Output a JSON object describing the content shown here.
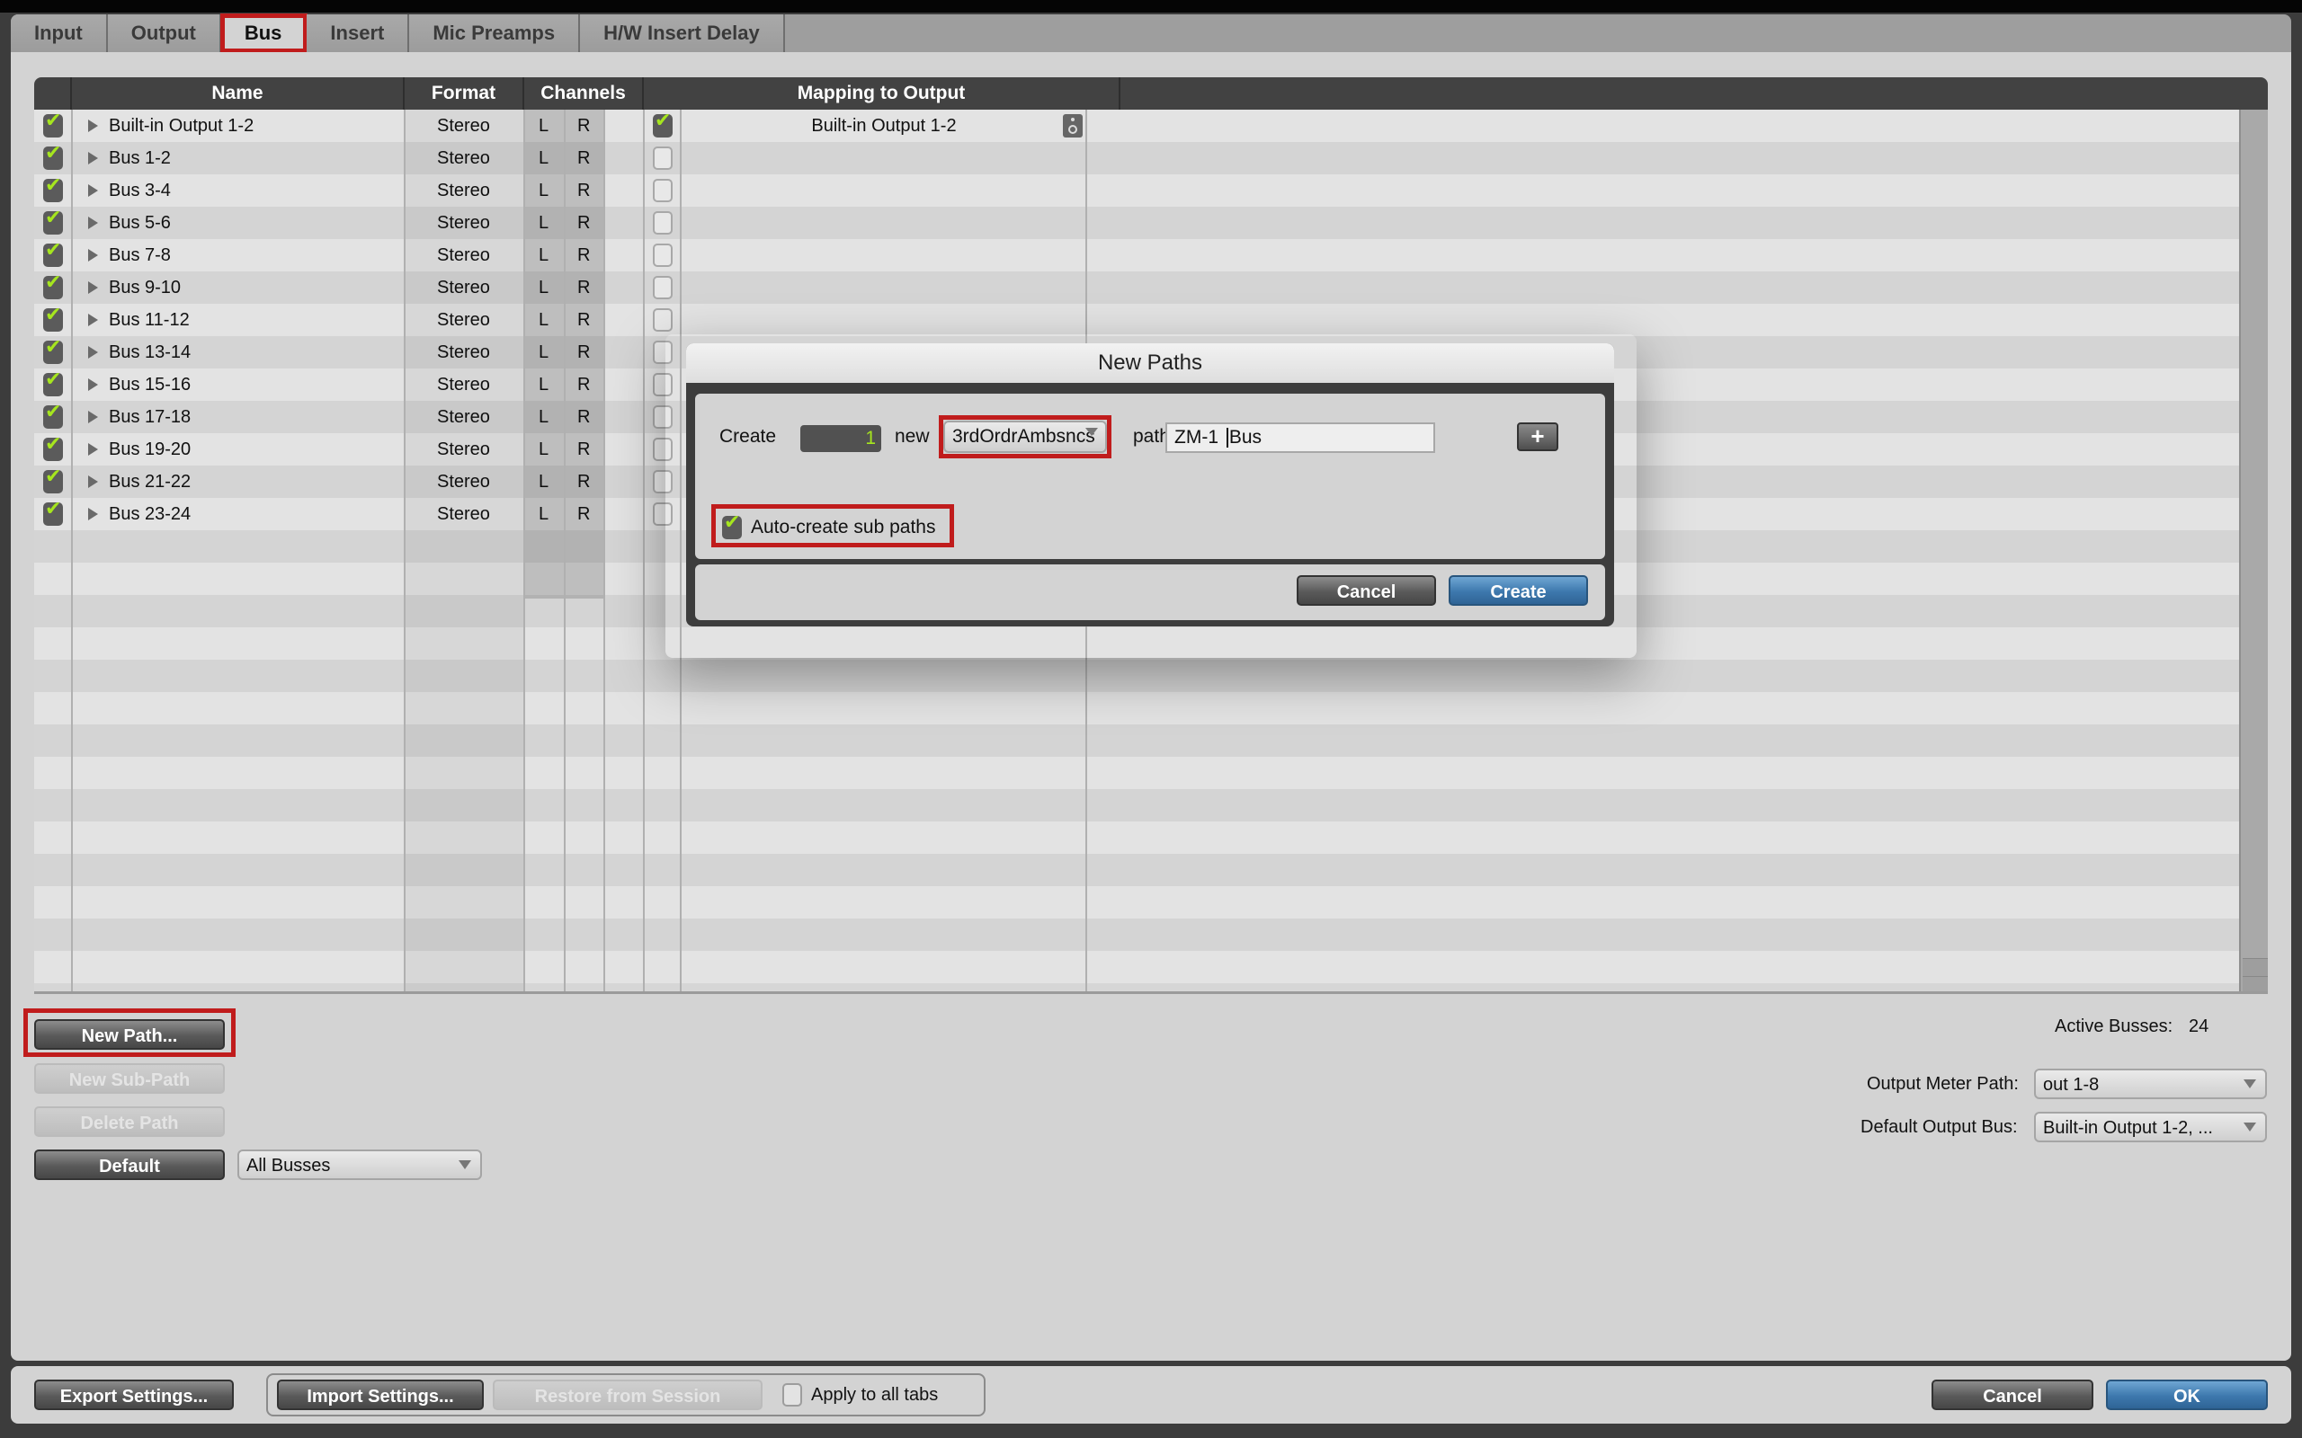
{
  "tabs": [
    {
      "label": "Input",
      "active": false
    },
    {
      "label": "Output",
      "active": false
    },
    {
      "label": "Bus",
      "active": true
    },
    {
      "label": "Insert",
      "active": false
    },
    {
      "label": "Mic Preamps",
      "active": false
    },
    {
      "label": "H/W Insert Delay",
      "active": false
    }
  ],
  "table": {
    "headers": {
      "name": "Name",
      "format": "Format",
      "channels": "Channels",
      "mapping": "Mapping to Output"
    },
    "rows": [
      {
        "active": true,
        "name": "Built-in Output 1-2",
        "format": "Stereo",
        "ch_l": "L",
        "ch_r": "R",
        "mapped": true,
        "mapping": "Built-in Output 1-2"
      },
      {
        "active": true,
        "name": "Bus 1-2",
        "format": "Stereo",
        "ch_l": "L",
        "ch_r": "R",
        "mapped": false,
        "mapping": ""
      },
      {
        "active": true,
        "name": "Bus 3-4",
        "format": "Stereo",
        "ch_l": "L",
        "ch_r": "R",
        "mapped": false,
        "mapping": ""
      },
      {
        "active": true,
        "name": "Bus 5-6",
        "format": "Stereo",
        "ch_l": "L",
        "ch_r": "R",
        "mapped": false,
        "mapping": ""
      },
      {
        "active": true,
        "name": "Bus 7-8",
        "format": "Stereo",
        "ch_l": "L",
        "ch_r": "R",
        "mapped": false,
        "mapping": ""
      },
      {
        "active": true,
        "name": "Bus 9-10",
        "format": "Stereo",
        "ch_l": "L",
        "ch_r": "R",
        "mapped": false,
        "mapping": ""
      },
      {
        "active": true,
        "name": "Bus 11-12",
        "format": "Stereo",
        "ch_l": "L",
        "ch_r": "R",
        "mapped": false,
        "mapping": ""
      },
      {
        "active": true,
        "name": "Bus 13-14",
        "format": "Stereo",
        "ch_l": "L",
        "ch_r": "R",
        "mapped": false,
        "mapping": ""
      },
      {
        "active": true,
        "name": "Bus 15-16",
        "format": "Stereo",
        "ch_l": "L",
        "ch_r": "R",
        "mapped": false,
        "mapping": ""
      },
      {
        "active": true,
        "name": "Bus 17-18",
        "format": "Stereo",
        "ch_l": "L",
        "ch_r": "R",
        "mapped": false,
        "mapping": ""
      },
      {
        "active": true,
        "name": "Bus 19-20",
        "format": "Stereo",
        "ch_l": "L",
        "ch_r": "R",
        "mapped": false,
        "mapping": ""
      },
      {
        "active": true,
        "name": "Bus 21-22",
        "format": "Stereo",
        "ch_l": "L",
        "ch_r": "R",
        "mapped": false,
        "mapping": ""
      },
      {
        "active": true,
        "name": "Bus 23-24",
        "format": "Stereo",
        "ch_l": "L",
        "ch_r": "R",
        "mapped": false,
        "mapping": ""
      }
    ]
  },
  "left_controls": {
    "new_path": "New Path...",
    "new_sub_path": "New Sub-Path",
    "delete_path": "Delete Path",
    "default": "Default",
    "filter_select": "All Busses"
  },
  "right_controls": {
    "active_busses_label": "Active Busses:",
    "active_busses_value": "24",
    "output_meter_label": "Output Meter Path:",
    "output_meter_value": "out 1-8",
    "default_output_label": "Default Output Bus:",
    "default_output_value": "Built-in Output 1-2, ..."
  },
  "footer": {
    "export": "Export Settings...",
    "import": "Import Settings...",
    "restore": "Restore from Session",
    "apply_all": "Apply to all tabs",
    "apply_all_checked": false,
    "cancel": "Cancel",
    "ok": "OK"
  },
  "dialog": {
    "title": "New Paths",
    "create_label": "Create",
    "count": "1",
    "new_label": "new",
    "format_select": "3rdOrdrAmbsncs",
    "path_label": "path",
    "path_before_caret": "ZM-1 ",
    "path_after_caret": "Bus",
    "add_button": "+",
    "auto_create_label": "Auto-create sub paths",
    "auto_create_checked": true,
    "cancel": "Cancel",
    "create": "Create"
  },
  "colors": {
    "highlight": "#c01c1c",
    "check_green": "#a6e61e",
    "primary_blue": "#3d78ad"
  }
}
